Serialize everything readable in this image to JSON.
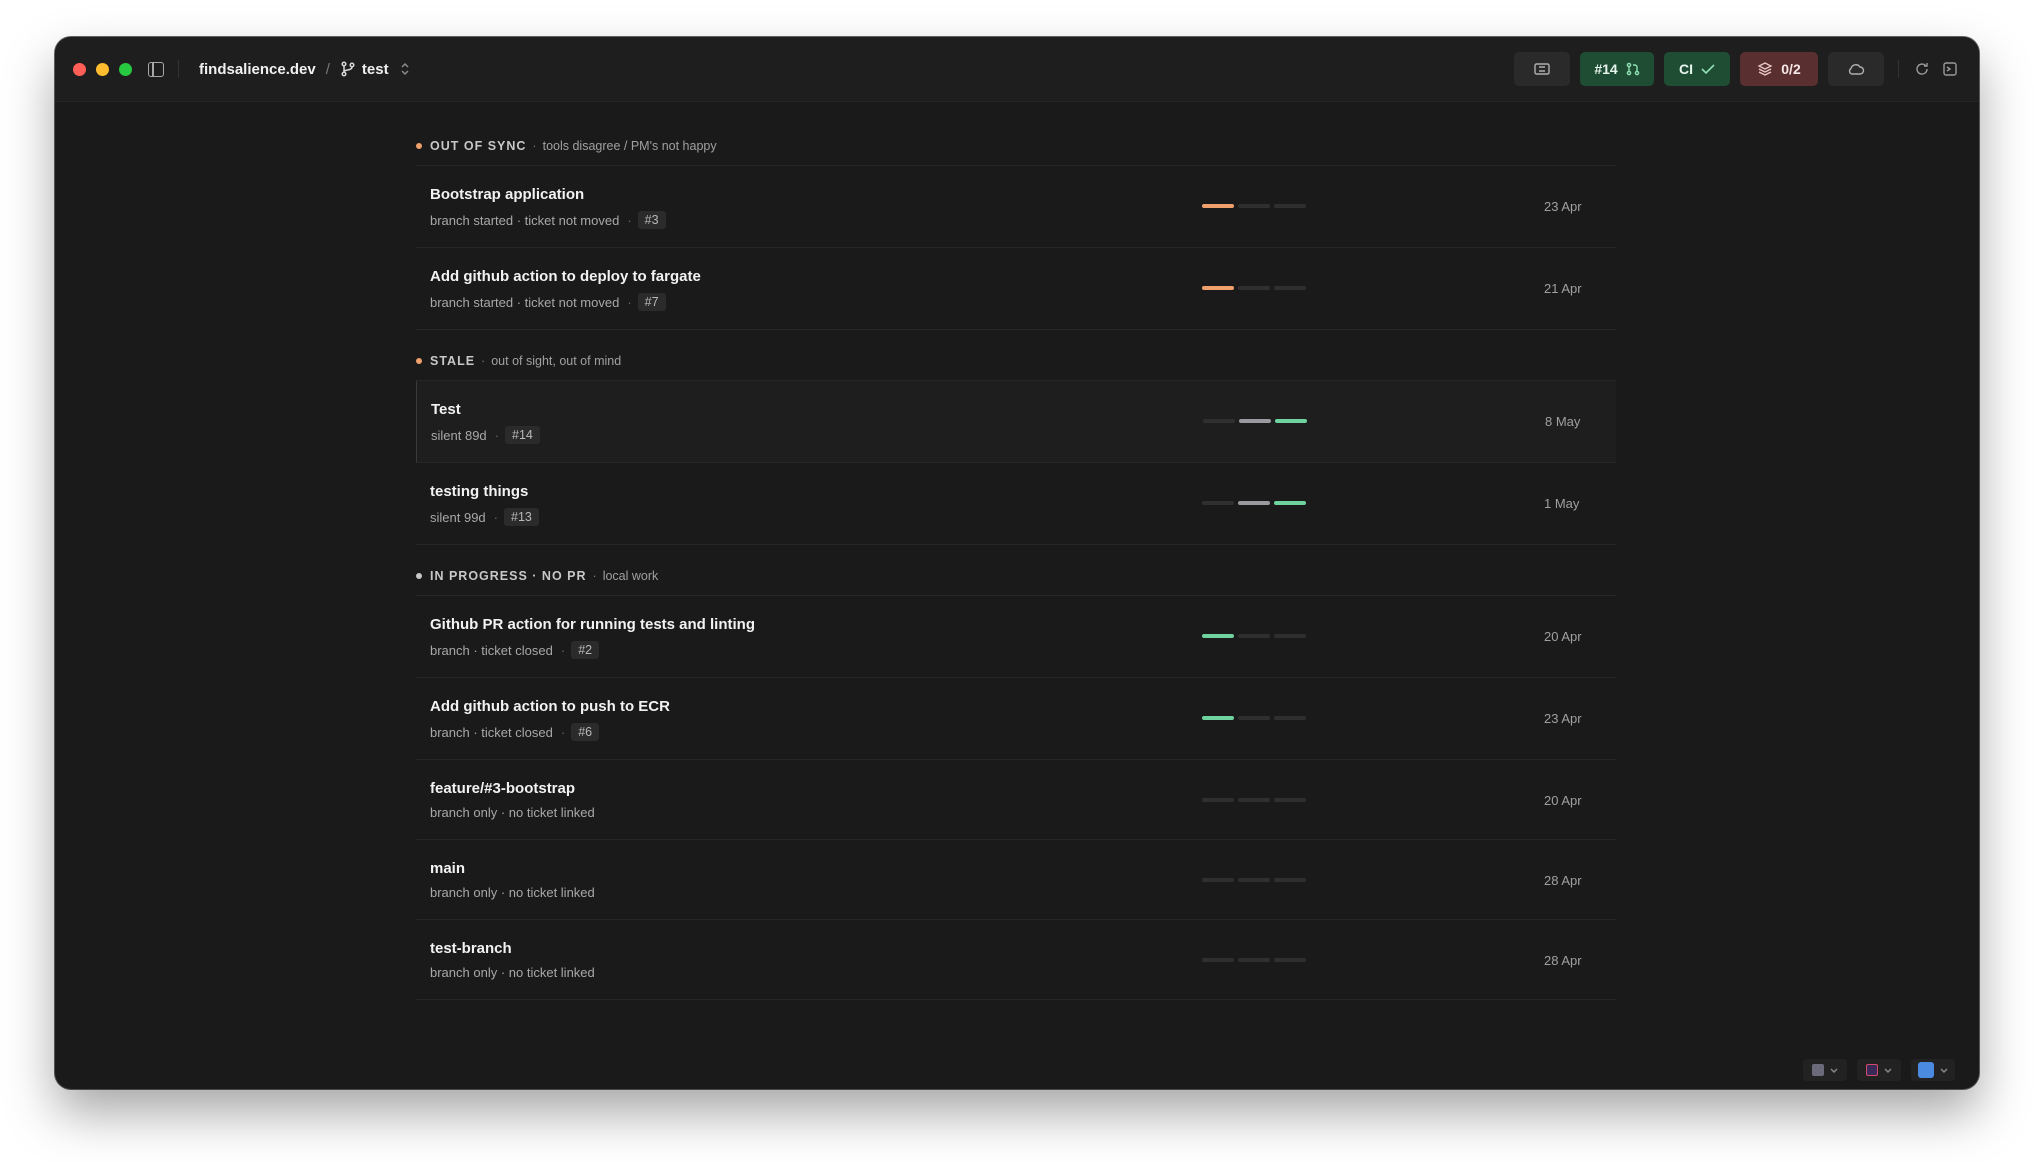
{
  "titlebar": {
    "project": "findsalience.dev",
    "separator": "/",
    "branch": "test",
    "pr_label": "#14",
    "ci_label": "CI",
    "stack_label": "0/2"
  },
  "sections": [
    {
      "title": "OUT OF SYNC",
      "subtitle": "tools disagree / PM's not happy",
      "bullet_color": "#f0a06c",
      "rows": [
        {
          "title": "Bootstrap application",
          "sub": "branch started · ticket not moved",
          "tag": "#3",
          "date": "23 Apr",
          "bars": [
            "#f0a06c",
            "#2f2f2f",
            "#2f2f2f"
          ]
        },
        {
          "title": "Add github action to deploy to fargate",
          "sub": "branch started · ticket not moved",
          "tag": "#7",
          "date": "21 Apr",
          "bars": [
            "#f0a06c",
            "#2f2f2f",
            "#2f2f2f"
          ]
        }
      ]
    },
    {
      "title": "STALE",
      "subtitle": "out of sight, out of mind",
      "bullet_color": "#f0a06c",
      "rows": [
        {
          "title": "Test",
          "sub": "silent 89d",
          "tag": "#14",
          "date": "8 May",
          "bars": [
            "#2f2f2f",
            "#9a9aa0",
            "#6fd3a0"
          ],
          "selected": true
        },
        {
          "title": "testing things",
          "sub": "silent 99d",
          "tag": "#13",
          "date": "1 May",
          "bars": [
            "#2f2f2f",
            "#9a9aa0",
            "#6fd3a0"
          ]
        }
      ]
    },
    {
      "title": "IN PROGRESS · NO PR",
      "subtitle": "local work",
      "bullet_color": "#c8c8c8",
      "rows": [
        {
          "title": "Github PR action for running tests and linting",
          "sub": "branch · ticket closed",
          "tag": "#2",
          "date": "20 Apr",
          "bars": [
            "#6fd3a0",
            "#2f2f2f",
            "#2f2f2f"
          ]
        },
        {
          "title": "Add github action to push to ECR",
          "sub": "branch · ticket closed",
          "tag": "#6",
          "date": "23 Apr",
          "bars": [
            "#6fd3a0",
            "#2f2f2f",
            "#2f2f2f"
          ]
        },
        {
          "title": "feature/#3-bootstrap",
          "sub": "branch only · no ticket linked",
          "tag": "",
          "date": "20 Apr",
          "bars": [
            "#2f2f2f",
            "#2f2f2f",
            "#2f2f2f"
          ]
        },
        {
          "title": "main",
          "sub": "branch only · no ticket linked",
          "tag": "",
          "date": "28 Apr",
          "bars": [
            "#2f2f2f",
            "#2f2f2f",
            "#2f2f2f"
          ]
        },
        {
          "title": "test-branch",
          "sub": "branch only · no ticket linked",
          "tag": "",
          "date": "28 Apr",
          "bars": [
            "#2f2f2f",
            "#2f2f2f",
            "#2f2f2f"
          ]
        }
      ]
    }
  ]
}
